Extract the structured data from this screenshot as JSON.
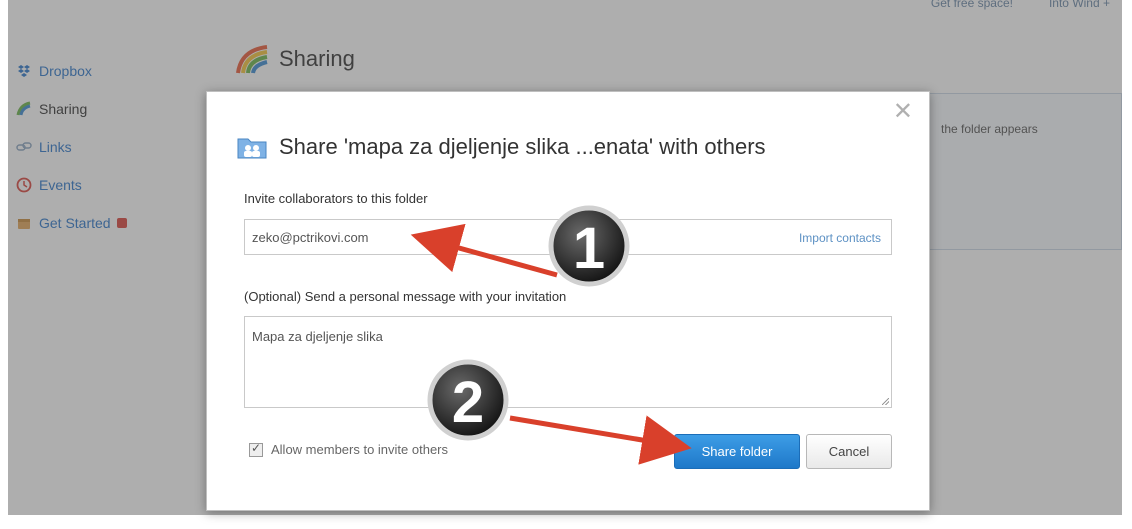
{
  "header": {
    "links": [
      "Get free space!",
      "Into Wind +"
    ]
  },
  "sidebar": {
    "items": [
      {
        "label": "Dropbox",
        "icon": "dropbox-box-icon"
      },
      {
        "label": "Sharing",
        "icon": "sharing-rainbow-icon"
      },
      {
        "label": "Links",
        "icon": "links-chain-icon"
      },
      {
        "label": "Events",
        "icon": "events-clock-icon"
      },
      {
        "label": "Get Started",
        "icon": "get-started-icon"
      }
    ]
  },
  "page": {
    "title": "Sharing",
    "background_panel_text": "the folder appears"
  },
  "modal": {
    "title": "Share 'mapa za djeljenje slika ...enata' with others",
    "close_symbol": "✕",
    "invite_label": "Invite collaborators to this folder",
    "invite_value": "zeko@pctrikovi.com",
    "import_contacts": "Import contacts",
    "message_label": "(Optional) Send a personal message with your invitation",
    "message_value": "Mapa za djeljenje slika",
    "allow_members_label": "Allow members to invite others",
    "allow_members_checked": true,
    "share_button": "Share folder",
    "cancel_button": "Cancel"
  },
  "callouts": {
    "one": "1",
    "two": "2"
  },
  "colors": {
    "primary_button": "#2a88d8",
    "link": "#5d91c4",
    "arrow": "#d9402b"
  }
}
